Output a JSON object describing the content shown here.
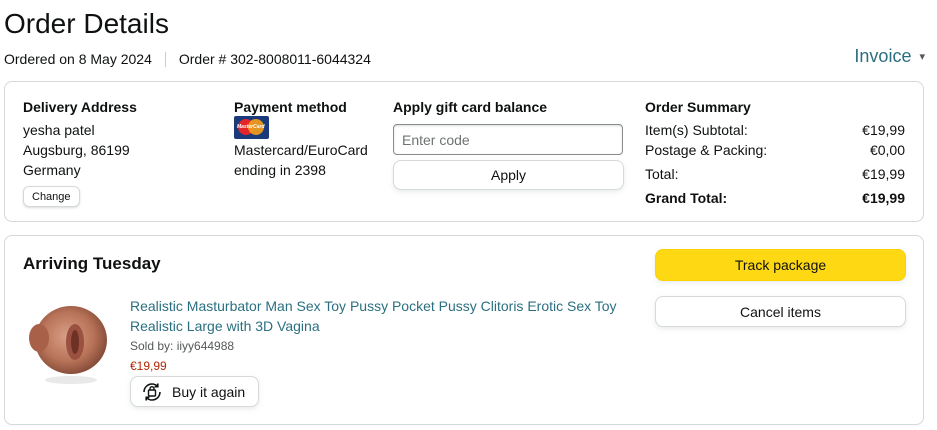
{
  "header": {
    "title": "Order Details",
    "ordered_on": "Ordered on 8 May 2024",
    "order_number": "Order # 302-8008011-6044324",
    "invoice_label": "Invoice"
  },
  "delivery": {
    "title": "Delivery Address",
    "name": "yesha patel",
    "city": "Augsburg, 86199",
    "country": "Germany",
    "change_label": "Change"
  },
  "payment": {
    "title": "Payment method",
    "card_logo_text": "MasterCard",
    "card_name": "Mastercard/EuroCard",
    "card_ending": "ending in 2398"
  },
  "gift_card": {
    "title": "Apply gift card balance",
    "placeholder": "Enter code",
    "value": "",
    "apply_label": "Apply"
  },
  "summary": {
    "title": "Order Summary",
    "rows": [
      {
        "label": "Item(s) Subtotal:",
        "value": "€19,99"
      },
      {
        "label": "Postage & Packing:",
        "value": "€0,00"
      },
      {
        "label": "Total:",
        "value": "€19,99"
      },
      {
        "label": "Grand Total:",
        "value": "€19,99"
      }
    ]
  },
  "shipment": {
    "status": "Arriving Tuesday",
    "track_label": "Track package",
    "cancel_label": "Cancel items",
    "item": {
      "title": "Realistic Masturbator Man Sex Toy Pussy Pocket Pussy Clitoris Erotic Sex Toy Realistic Large with 3D Vagina",
      "sold_by": "Sold by: iiyy644988",
      "price": "€19,99",
      "buy_again_label": "Buy it again"
    }
  },
  "colors": {
    "link": "#2a6f7f",
    "price": "#b12704",
    "primary_button": "#ffd814",
    "border": "#d5d9d9"
  }
}
